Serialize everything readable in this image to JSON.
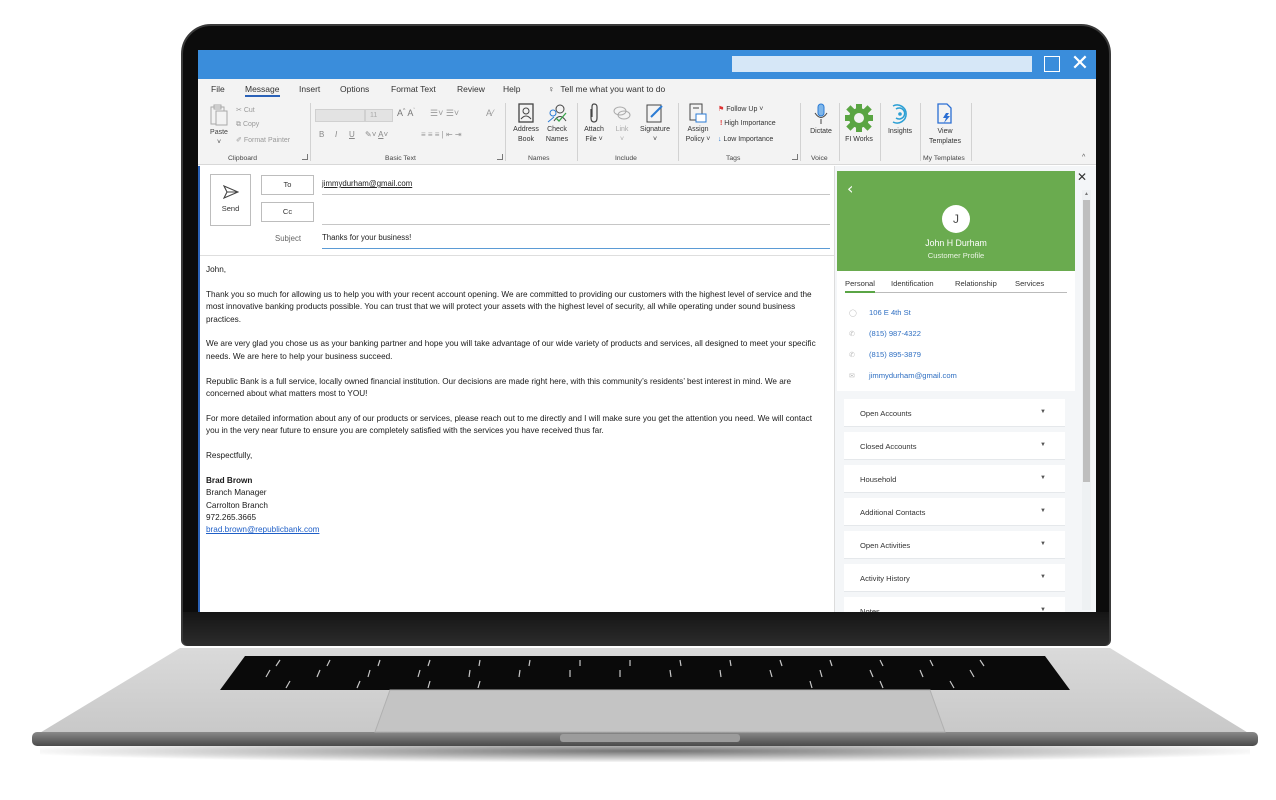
{
  "window": {
    "maximize_icon": "maximize-icon",
    "close_icon": "close-icon"
  },
  "menu": {
    "tabs": [
      "File",
      "Message",
      "Insert",
      "Options",
      "Format Text",
      "Review",
      "Help"
    ],
    "active_tab": "Message",
    "tell_me": "Tell me what you want to do"
  },
  "ribbon": {
    "clipboard": {
      "paste": "Paste",
      "cut": "Cut",
      "copy": "Copy",
      "format_painter": "Format Painter",
      "label": "Clipboard"
    },
    "basic_text": {
      "font_size": "11",
      "label": "Basic Text",
      "bold": "B",
      "italic": "I",
      "underline": "U"
    },
    "names": {
      "address_book": [
        "Address",
        "Book"
      ],
      "check_names": [
        "Check",
        "Names"
      ],
      "label": "Names"
    },
    "include": {
      "attach_file": [
        "Attach",
        "File ˅"
      ],
      "link": [
        "Link",
        "˅"
      ],
      "signature": [
        "Signature",
        "˅"
      ],
      "label": "Include"
    },
    "tags": {
      "assign_policy": [
        "Assign",
        "Policy ˅"
      ],
      "follow_up": "Follow Up ˅",
      "high_importance": "High Importance",
      "low_importance": "Low Importance",
      "label": "Tags"
    },
    "voice": {
      "dictate": "Dictate",
      "label": "Voice"
    },
    "fi_works": {
      "label": "FI Works",
      "color": "#5aa543"
    },
    "insights": {
      "label": "Insights"
    },
    "templates": {
      "view_templates": [
        "View",
        "Templates"
      ],
      "label": "My Templates"
    }
  },
  "compose": {
    "send": "Send",
    "to_label": "To",
    "cc_label": "Cc",
    "subject_label": "Subject",
    "to_value": "jimmydurham@gmail.com",
    "cc_value": "",
    "subject_value": "Thanks for your business!",
    "body": {
      "greeting": "John,",
      "paragraphs": [
        "Thank you so much for allowing us to help you with your recent account opening.  We are committed to providing our customers with the highest level of service and the most innovative banking products possible.  You can trust that we will protect your assets with the highest level of security, all while operating under sound business practices.",
        "We are very glad you chose us as your banking partner and hope you will take advantage of our wide variety of products and services, all designed to meet your specific needs.  We are here to help your business succeed.",
        "Republic Bank is a full service, locally owned financial institution.  Our decisions are made right here, with this community’s residents’ best interest in mind.  We are concerned about what matters most to YOU!",
        "For more detailed information about any of our products or services, please reach out to me directly and I will make sure you get the attention you need.  We will contact you in the very near future to ensure you are completely satisfied with the services you have received thus far."
      ],
      "closing": "Respectfully,",
      "signature": {
        "name": "Brad Brown",
        "title": "Branch Manager",
        "branch": "Carrolton Branch",
        "phone": "972.265.3665",
        "email": "brad.brown@republicbank.com"
      }
    }
  },
  "customer_panel": {
    "header_color": "#6aab4f",
    "avatar_initial": "J",
    "name": "John H Durham",
    "subtitle": "Customer Profile",
    "tabs": [
      "Personal",
      "Identification",
      "Relationship",
      "Services"
    ],
    "active_tab": "Personal",
    "contacts": [
      {
        "icon": "location-pin-icon",
        "value": "106 E 4th St"
      },
      {
        "icon": "phone-icon",
        "value": "(815) 987-4322"
      },
      {
        "icon": "phone-icon",
        "value": "(815) 895-3879"
      },
      {
        "icon": "email-icon",
        "value": "jimmydurham@gmail.com"
      }
    ],
    "sections": [
      "Open Accounts",
      "Closed Accounts",
      "Household",
      "Additional Contacts",
      "Open Activities",
      "Activity History",
      "Notes"
    ]
  }
}
